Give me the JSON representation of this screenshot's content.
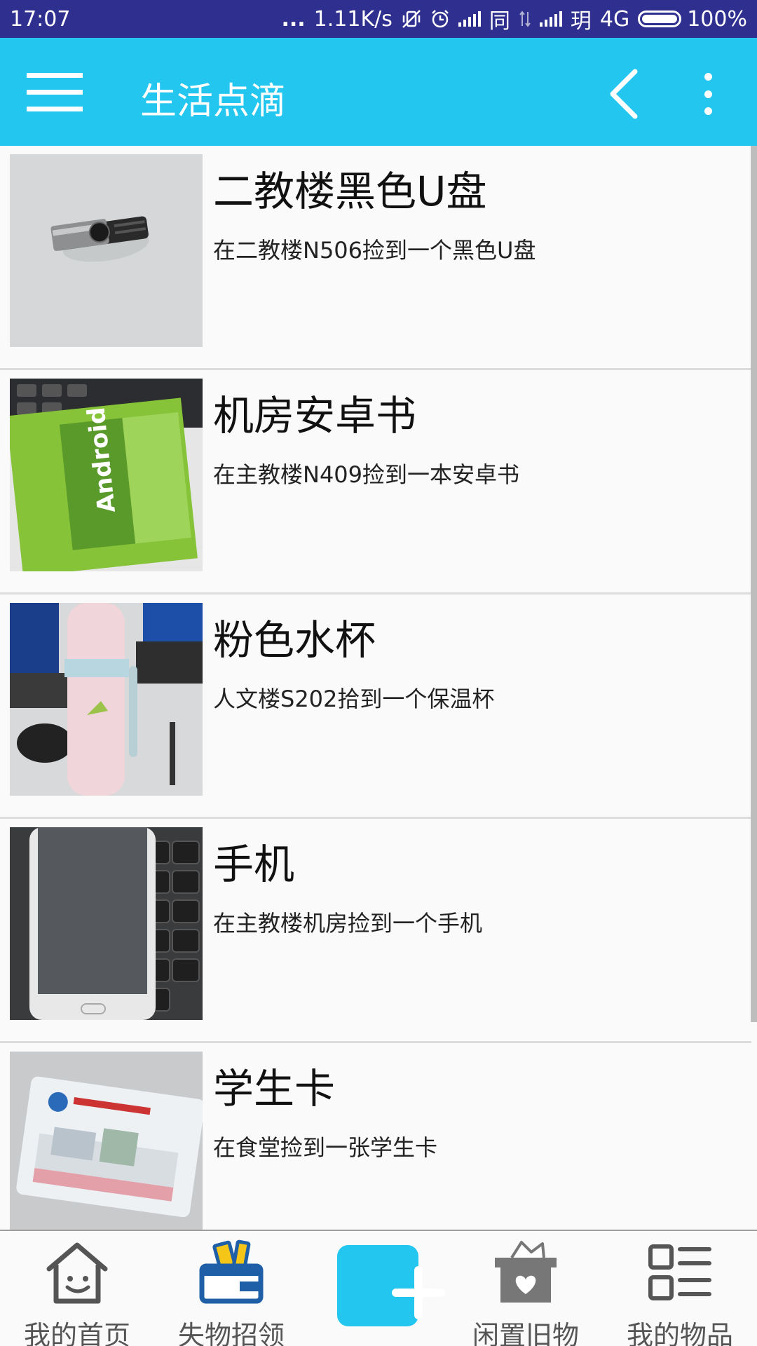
{
  "status_bar": {
    "time": "17:07",
    "dots": "...",
    "net_speed": "1.11K/s",
    "sim1_label": "同",
    "sim2_label": "玥",
    "network": "4G",
    "battery": "100%"
  },
  "app_bar": {
    "title": "生活点滴",
    "menu_icon": "hamburger-menu-icon",
    "back_icon": "chevron-left-icon",
    "more_icon": "more-vertical-icon"
  },
  "items": [
    {
      "title": "二教楼黑色U盘",
      "description": "在二教楼N506捡到一个黑色U盘",
      "image": "usb-drive-photo"
    },
    {
      "title": "机房安卓书",
      "description": "在主教楼N409捡到一本安卓书",
      "image": "android-book-photo"
    },
    {
      "title": "粉色水杯",
      "description": "人文楼S202拾到一个保温杯",
      "image": "pink-cup-photo"
    },
    {
      "title": "手机",
      "description": "在主教楼机房捡到一个手机",
      "image": "phone-photo"
    },
    {
      "title": "学生卡",
      "description": "在食堂捡到一张学生卡",
      "image": "student-card-photo"
    }
  ],
  "bottom_nav": {
    "tabs": [
      {
        "label": "我的首页",
        "icon": "home-icon"
      },
      {
        "label": "失物招领",
        "icon": "wallet-icon"
      },
      {
        "label": "",
        "icon": "add-icon"
      },
      {
        "label": "闲置旧物",
        "icon": "gift-box-icon"
      },
      {
        "label": "我的物品",
        "icon": "list-icon"
      }
    ]
  },
  "colors": {
    "status_bar": "#2e2f8e",
    "app_bar": "#22c6ef",
    "accent": "#22c6ef",
    "wallet_accent": "#1e5fa8",
    "wallet_highlight": "#f5c518"
  }
}
